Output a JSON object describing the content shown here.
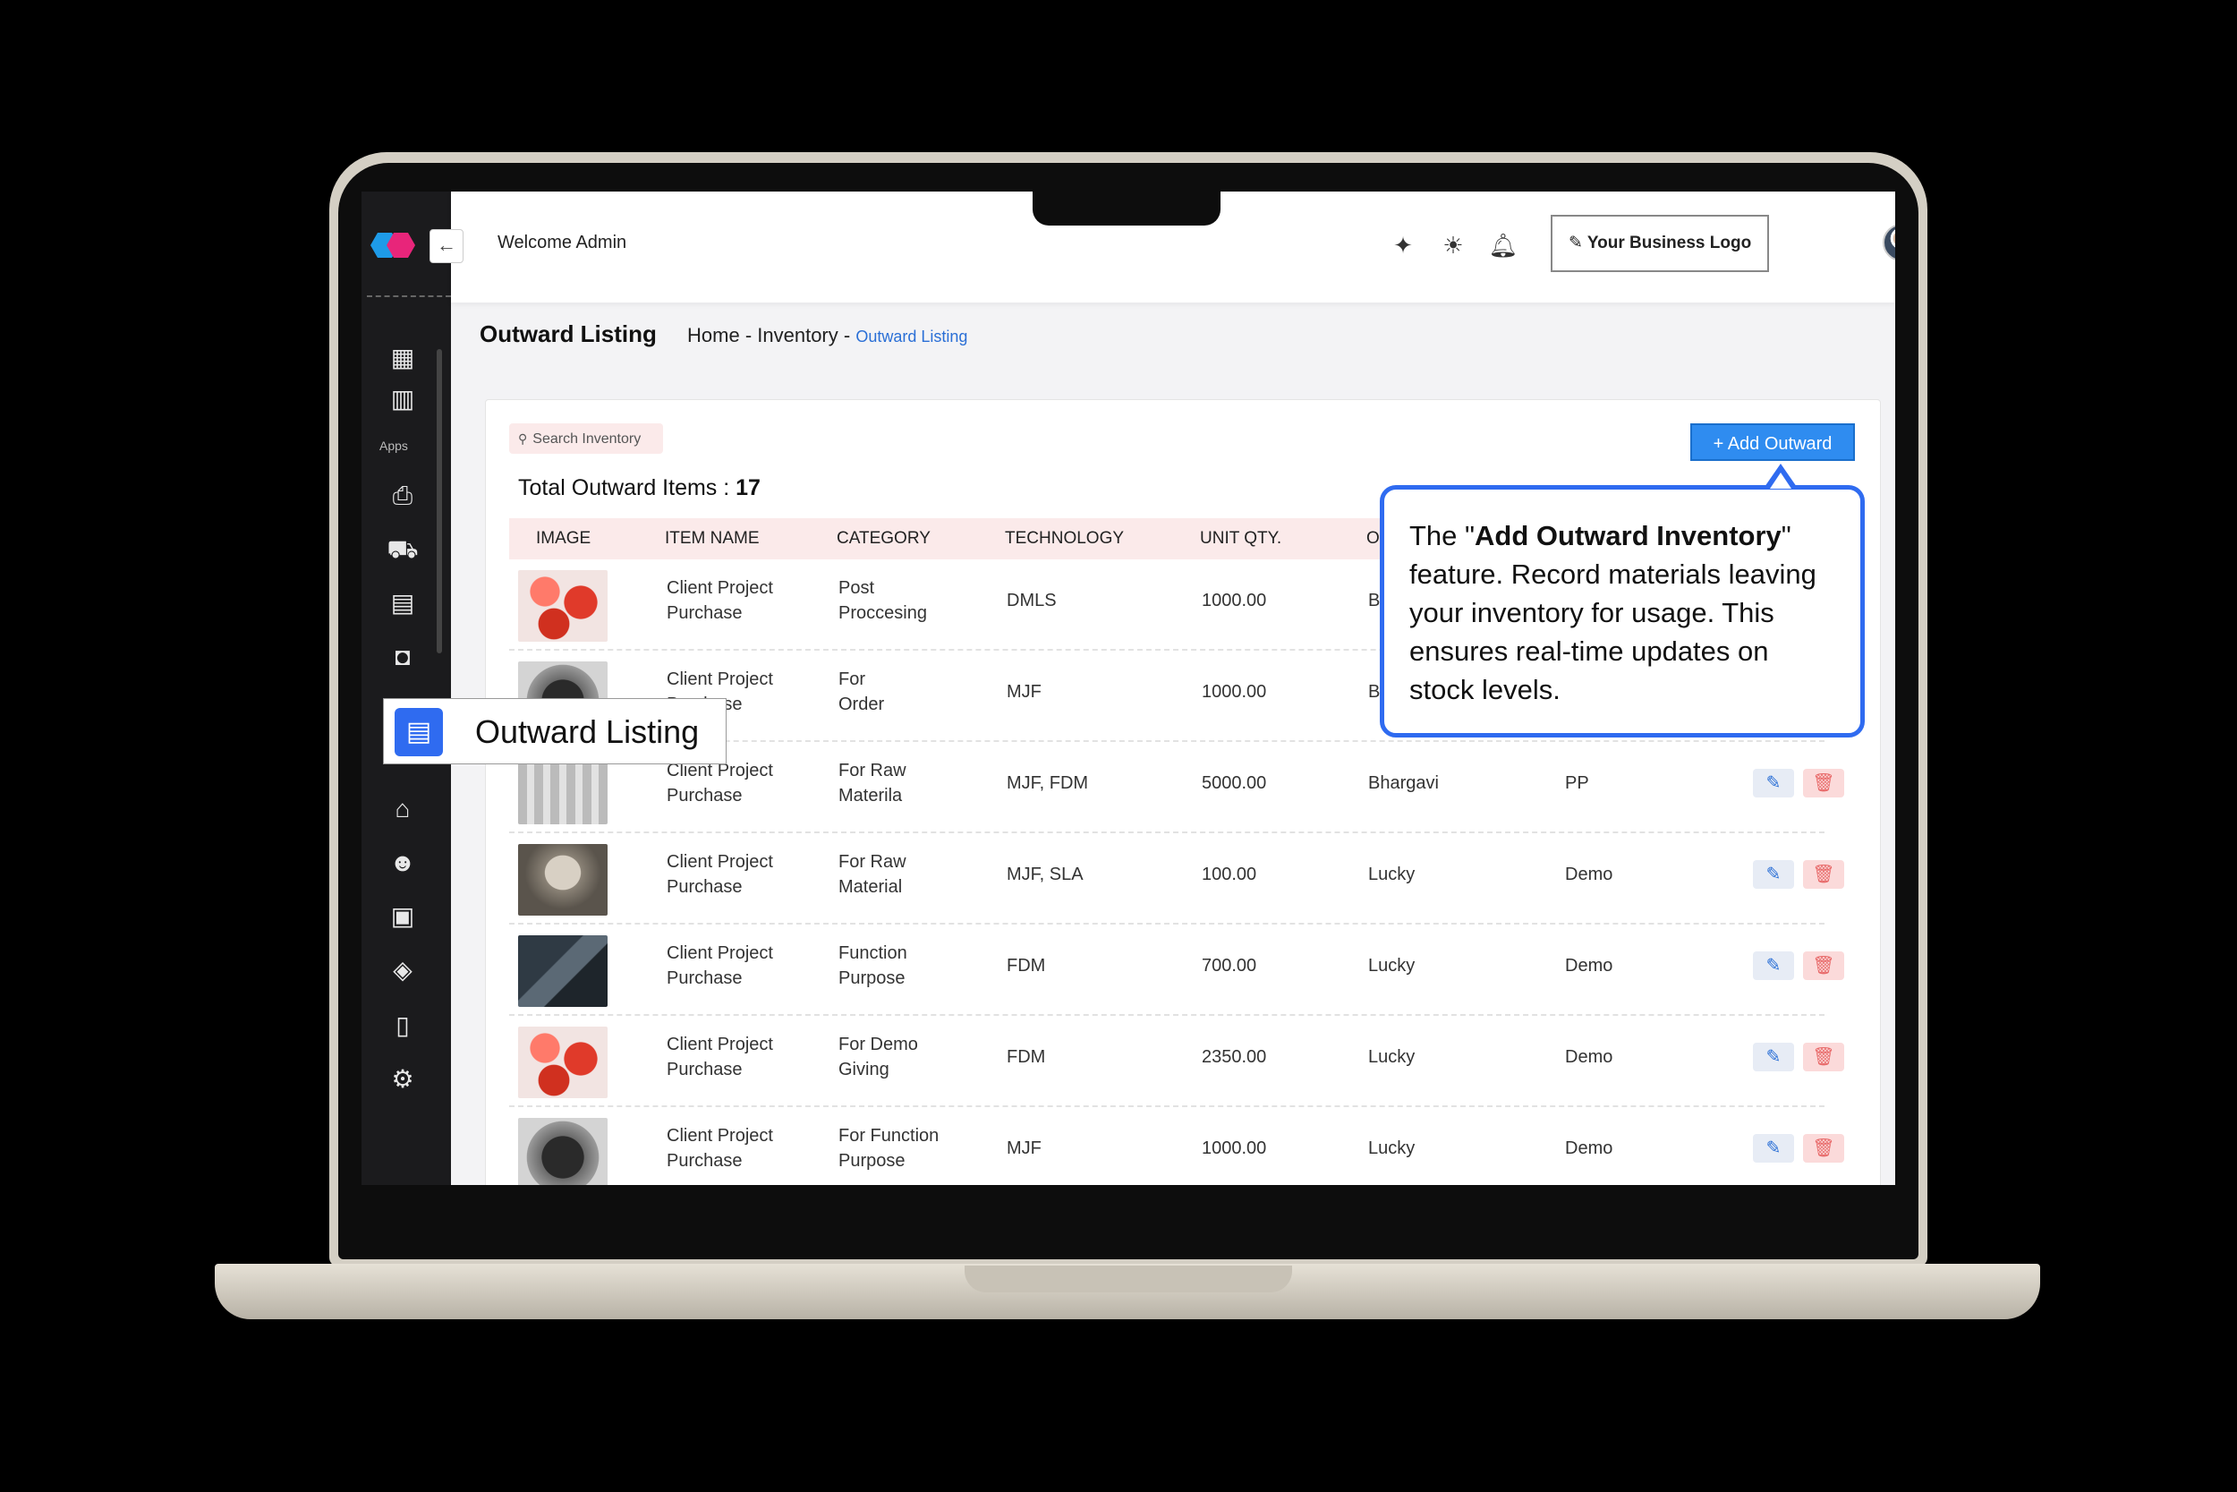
{
  "topbar": {
    "welcome": "Welcome Admin",
    "business_logo": "Your Business Logo",
    "icons": [
      "sparkle-icon",
      "sun-icon",
      "bell-icon",
      "pencil-icon",
      "avatar",
      "help-icon"
    ]
  },
  "sidebar": {
    "apps_label": "Apps",
    "collapse_glyph": "←",
    "icons": [
      "dashboard-icon",
      "chart-icon",
      "printer-icon",
      "truck-icon",
      "kanban-icon",
      "bag-icon",
      "bank-icon",
      "user-edit-icon",
      "chip-icon",
      "tag-icon",
      "book-icon",
      "settings-icon"
    ],
    "tooltip_label": "Outward Listing"
  },
  "page": {
    "title": "Outward Listing",
    "breadcrumb_home": "Home",
    "breadcrumb_inventory": "Inventory",
    "breadcrumb_active": "Outward Listing",
    "separator": "-"
  },
  "toolbar": {
    "search_placeholder": "Search Inventory",
    "add_button": "+ Add Outward",
    "total_label": "Total Outward Items :",
    "total_count": "17"
  },
  "table": {
    "columns": [
      "IMAGE",
      "ITEM NAME",
      "CATEGORY",
      "TECHNOLOGY",
      "UNIT QTY.",
      "OU"
    ],
    "rows": [
      {
        "image": "red-parts",
        "name_1": "Client Project",
        "name_2": "Purchase",
        "cat_1": "Post",
        "cat_2": "Proccesing",
        "tech": "DMLS",
        "qty": "1000.00",
        "out": "Bh",
        "col7": ""
      },
      {
        "image": "dark-part",
        "name_1": "Client Project",
        "name_2": "Purchase",
        "cat_1": "For",
        "cat_2": "Order",
        "tech": "MJF",
        "qty": "1000.00",
        "out": "Bh",
        "col7": ""
      },
      {
        "image": "qr-part",
        "name_1": "Client Project",
        "name_2": "Purchase",
        "cat_1": "For Raw",
        "cat_2": "Materila",
        "tech": "MJF, FDM",
        "qty": "5000.00",
        "out": "Bhargavi",
        "col7": "PP"
      },
      {
        "image": "bust",
        "name_1": "Client Project",
        "name_2": "Purchase",
        "cat_1": "For Raw",
        "cat_2": "Material",
        "tech": "MJF, SLA",
        "qty": "100.00",
        "out": "Lucky",
        "col7": "Demo"
      },
      {
        "image": "machine",
        "name_1": "Client Project",
        "name_2": "Purchase",
        "cat_1": "Function",
        "cat_2": "Purpose",
        "tech": "FDM",
        "qty": "700.00",
        "out": "Lucky",
        "col7": "Demo"
      },
      {
        "image": "red-parts",
        "name_1": "Client Project",
        "name_2": "Purchase",
        "cat_1": "For Demo",
        "cat_2": "Giving",
        "tech": "FDM",
        "qty": "2350.00",
        "out": "Lucky",
        "col7": "Demo"
      },
      {
        "image": "dark-part",
        "name_1": "Client Project",
        "name_2": "Purchase",
        "cat_1": "For Function",
        "cat_2": "Purpose",
        "tech": "MJF",
        "qty": "1000.00",
        "out": "Lucky",
        "col7": "Demo"
      }
    ]
  },
  "callout": {
    "pre": "The \"",
    "bold": "Add Outward Inventory",
    "post": "\" feature. Record materials leaving your inventory for usage. This ensures real-time updates on stock levels."
  },
  "colors": {
    "accent": "#2f8cf0",
    "callout_border": "#2f6bf0",
    "header_bg": "#fbeaea",
    "delete": "#e86a6a",
    "sidebar_bg": "#1b1b1d"
  }
}
